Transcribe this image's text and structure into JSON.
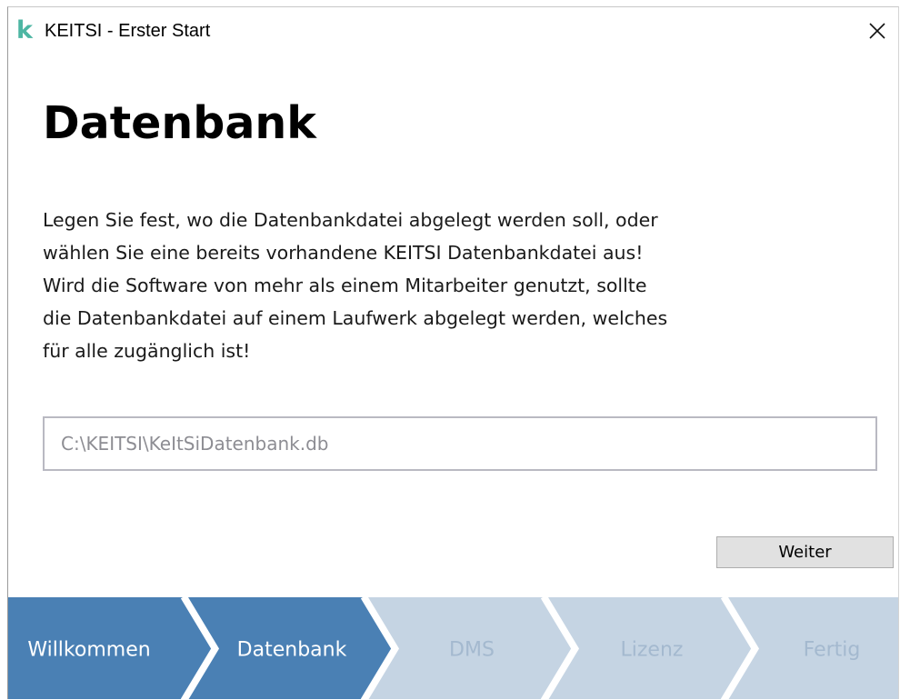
{
  "window": {
    "app_logo": "k",
    "title": "KEITSI - Erster Start",
    "close_label": "×"
  },
  "page": {
    "heading": "Datenbank",
    "description_lines": [
      "Legen Sie fest, wo die Datenbankdatei abgelegt werden soll, oder",
      "wählen Sie eine bereits vorhandene KEITSI Datenbankdatei aus!",
      "Wird die Software von mehr als einem Mitarbeiter genutzt, sollte",
      "die Datenbankdatei auf einem Laufwerk abgelegt werden, welches",
      "für alle zugänglich ist!"
    ]
  },
  "path_field": {
    "value": "C:\\KEITSI\\KeItSiDatenbank.db"
  },
  "buttons": {
    "next_label": "Weiter"
  },
  "wizard": {
    "steps": [
      {
        "label": "Willkommen",
        "state": "done"
      },
      {
        "label": "Datenbank",
        "state": "active"
      },
      {
        "label": "DMS",
        "state": "pending"
      },
      {
        "label": "Lizenz",
        "state": "pending"
      },
      {
        "label": "Fertig",
        "state": "pending"
      }
    ]
  },
  "colors": {
    "accent_logo": "#4db6a3",
    "step_active": "#4a80b4",
    "step_pending": "#c5d4e3",
    "step_text_active": "#ffffff",
    "step_text_pending": "#a4b9cf"
  }
}
